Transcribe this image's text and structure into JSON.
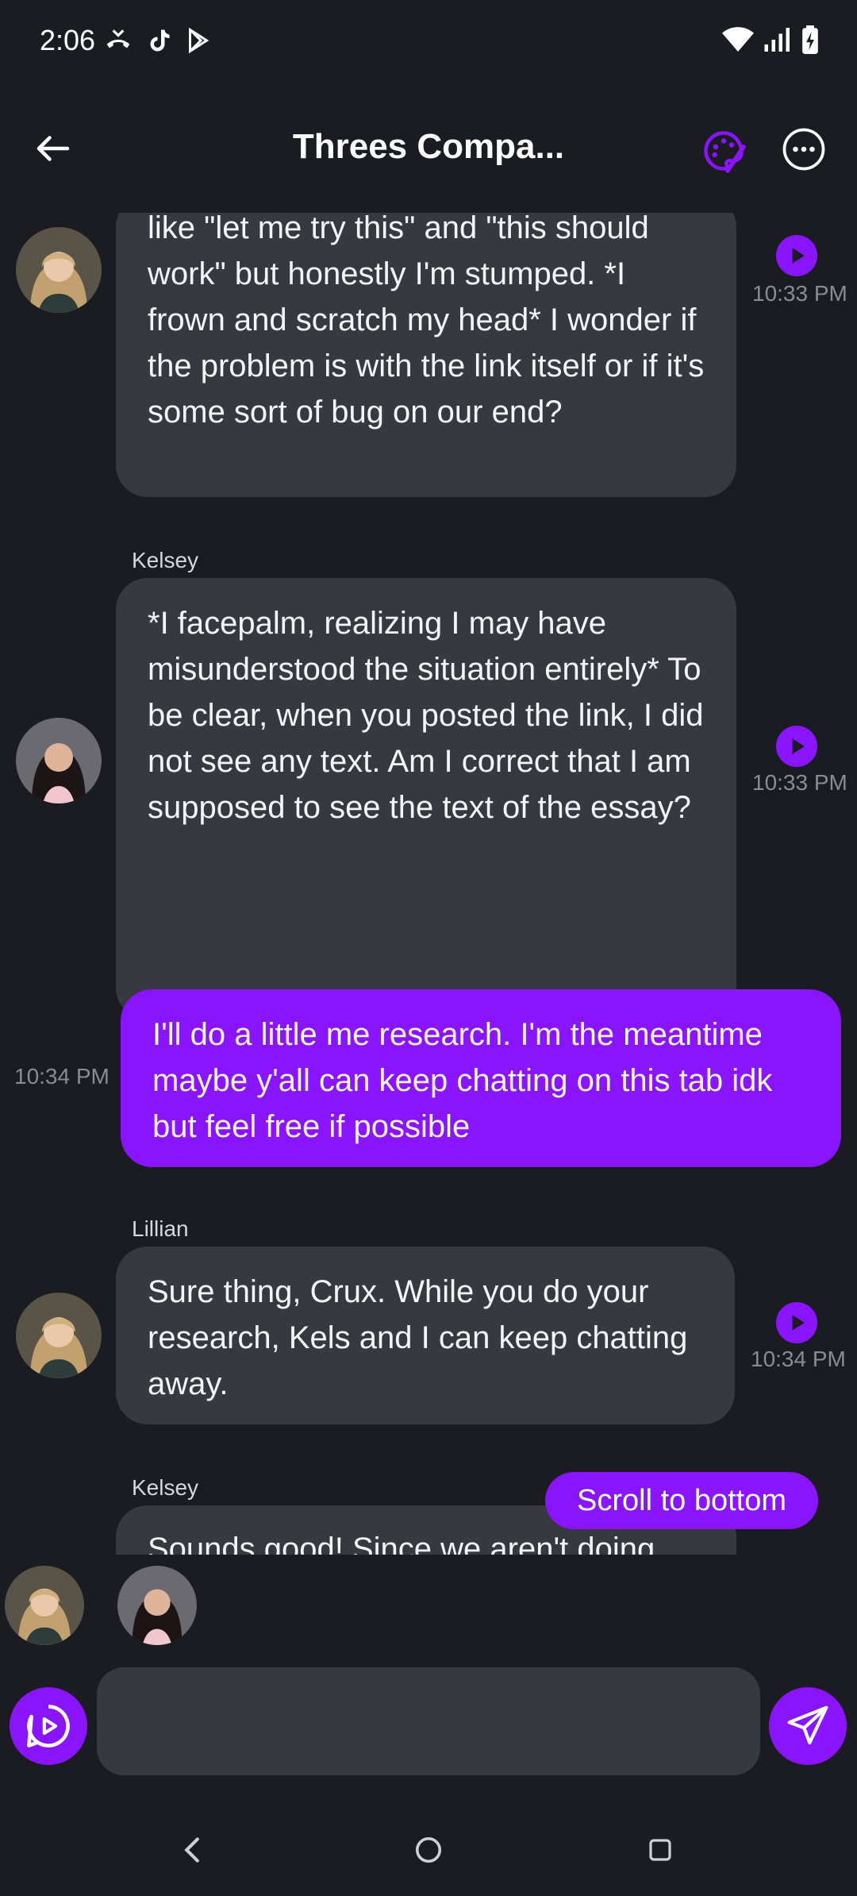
{
  "status_bar": {
    "time": "2:06",
    "left_icons": [
      "missed-call-icon",
      "tiktok-icon",
      "play-store-icon"
    ],
    "right_icons": [
      "wifi-icon",
      "signal-icon",
      "battery-charging-icon"
    ]
  },
  "header": {
    "title": "Threes Compa...",
    "back_icon": "arrow-left-icon",
    "palette_icon": "palette-icon",
    "menu_icon": "more-horizontal-icon",
    "accent_color": "#8b14ff"
  },
  "messages": [
    {
      "sender": "",
      "avatar": "lillian-avatar",
      "text": "like \"let me try this\" and \"this should work\" but honestly I'm stumped. *I frown and scratch my head* I wonder if the problem is with the link itself or if it's some sort of bug on our end?",
      "time": "10:33 PM",
      "mine": false
    },
    {
      "sender": "Kelsey",
      "avatar": "kelsey-avatar",
      "text": "*I facepalm, realizing I may have misunderstood the situation entirely* To be clear, when you posted the link, I did not see any text. Am I correct that I am supposed to see the text of the essay?",
      "time": "10:33 PM",
      "mine": false
    },
    {
      "sender": "",
      "avatar": "",
      "text": "I'll do a little me research. I'm the meantime maybe y'all can keep chatting on this tab idk but feel free if possible",
      "time": "10:34 PM",
      "mine": true
    },
    {
      "sender": "Lillian",
      "avatar": "lillian-avatar",
      "text": "Sure thing, Crux. While you do your research, Kels and I can keep chatting away.",
      "time": "10:34 PM",
      "mine": false
    },
    {
      "sender": "Kelsey",
      "avatar": "kelsey-avatar",
      "text": "Sounds good! Since we aren't doing",
      "time": "",
      "mine": false
    }
  ],
  "scroll_button": {
    "label": "Scroll to bottom"
  },
  "participants": [
    "lillian-avatar",
    "kelsey-avatar"
  ],
  "composer": {
    "placeholder": "",
    "voice_icon": "voice-play-icon",
    "send_icon": "send-icon"
  },
  "nav_bar": {
    "icons": [
      "nav-back-icon",
      "nav-home-icon",
      "nav-recents-icon"
    ]
  }
}
